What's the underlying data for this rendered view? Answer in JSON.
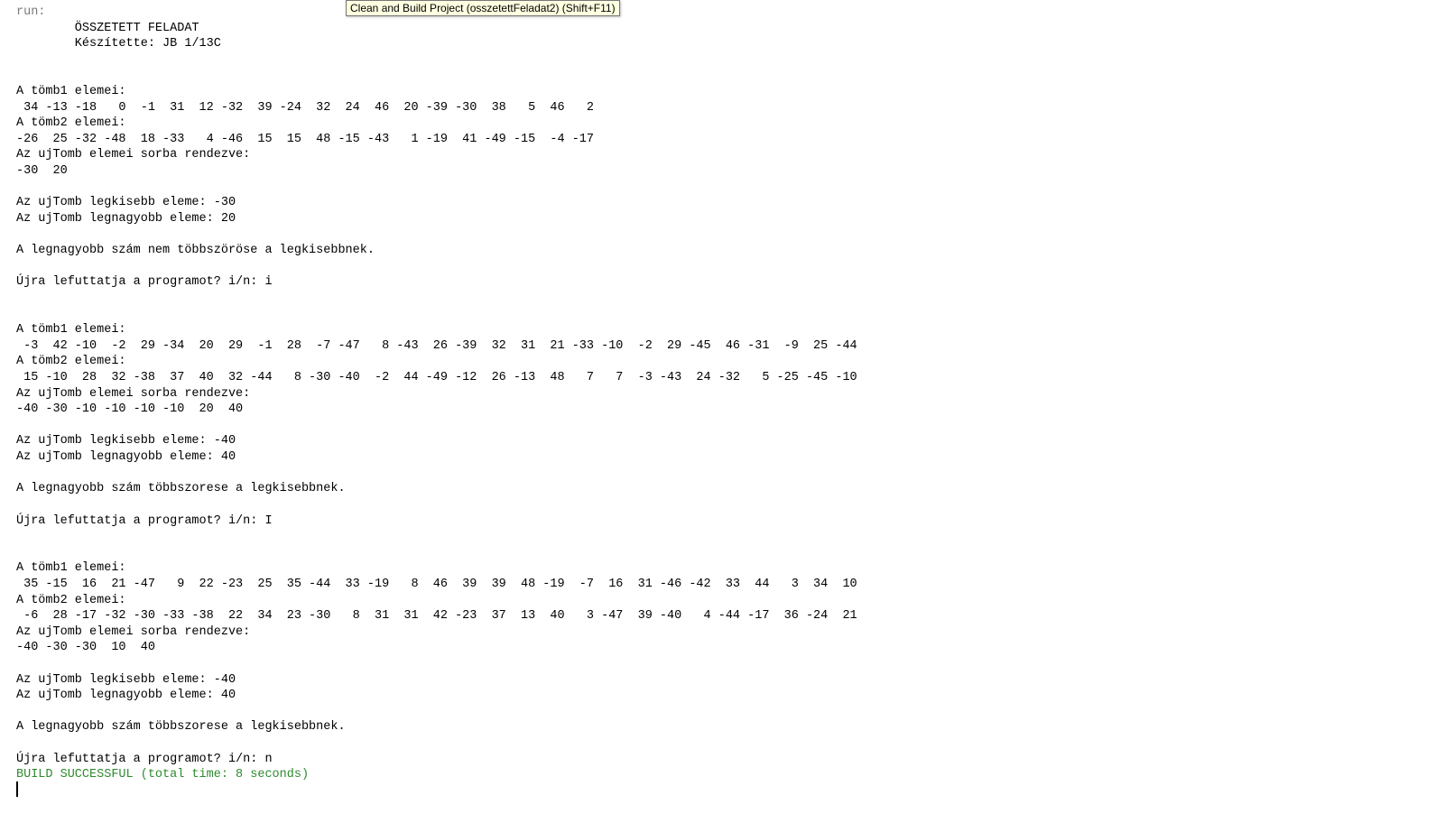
{
  "tooltip": {
    "text": "Clean and Build Project (osszetettFeladat2) (Shift+F11)"
  },
  "colors": {
    "background": "#ffffff",
    "text": "#000000",
    "muted": "#7a7a7a",
    "success": "#2e8b2e",
    "tooltip_bg": "#ffffe1"
  },
  "console": {
    "lines": [
      "run:",
      "        ÖSSZETETT FELADAT",
      "        Készítette: JB 1/13C",
      "",
      "",
      "A tömb1 elemei:",
      " 34 -13 -18   0  -1  31  12 -32  39 -24  32  24  46  20 -39 -30  38   5  46   2",
      "A tömb2 elemei:",
      "-26  25 -32 -48  18 -33   4 -46  15  15  48 -15 -43   1 -19  41 -49 -15  -4 -17",
      "Az ujTomb elemei sorba rendezve:",
      "-30  20",
      "",
      "Az ujTomb legkisebb eleme: -30",
      "Az ujTomb legnagyobb eleme: 20",
      "",
      "A legnagyobb szám nem többszöröse a legkisebbnek.",
      "",
      "Újra lefuttatja a programot? i/n: i",
      "",
      "",
      "A tömb1 elemei:",
      " -3  42 -10  -2  29 -34  20  29  -1  28  -7 -47   8 -43  26 -39  32  31  21 -33 -10  -2  29 -45  46 -31  -9  25 -44",
      "A tömb2 elemei:",
      " 15 -10  28  32 -38  37  40  32 -44   8 -30 -40  -2  44 -49 -12  26 -13  48   7   7  -3 -43  24 -32   5 -25 -45 -10",
      "Az ujTomb elemei sorba rendezve:",
      "-40 -30 -10 -10 -10 -10  20  40",
      "",
      "Az ujTomb legkisebb eleme: -40",
      "Az ujTomb legnagyobb eleme: 40",
      "",
      "A legnagyobb szám többszorese a legkisebbnek.",
      "",
      "Újra lefuttatja a programot? i/n: I",
      "",
      "",
      "A tömb1 elemei:",
      " 35 -15  16  21 -47   9  22 -23  25  35 -44  33 -19   8  46  39  39  48 -19  -7  16  31 -46 -42  33  44   3  34  10",
      "A tömb2 elemei:",
      " -6  28 -17 -32 -30 -33 -38  22  34  23 -30   8  31  31  42 -23  37  13  40   3 -47  39 -40   4 -44 -17  36 -24  21",
      "Az ujTomb elemei sorba rendezve:",
      "-40 -30 -30  10  40",
      "",
      "Az ujTomb legkisebb eleme: -40",
      "Az ujTomb legnagyobb eleme: 40",
      "",
      "A legnagyobb szám többszorese a legkisebbnek.",
      "",
      "Újra lefuttatja a programot? i/n: n",
      "BUILD SUCCESSFUL (total time: 8 seconds)"
    ]
  }
}
